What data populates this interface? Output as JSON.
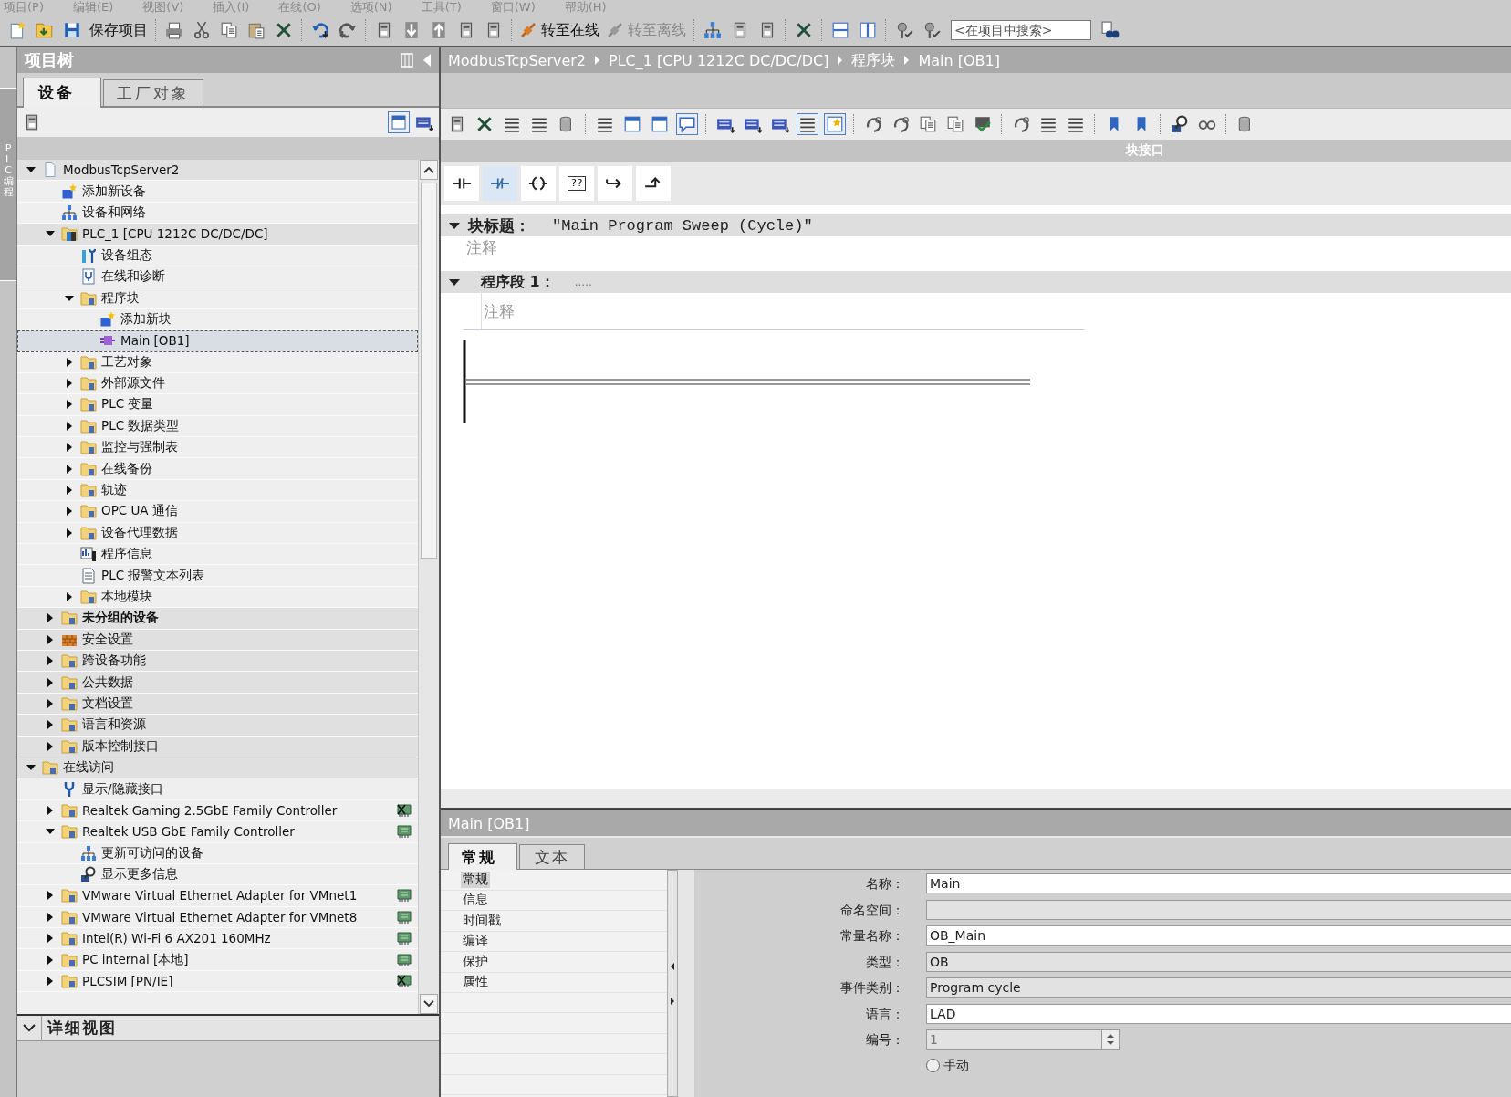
{
  "menu": [
    {
      "label": "项目(P)"
    },
    {
      "label": "编辑(E)"
    },
    {
      "label": "视图(V)"
    },
    {
      "label": "插入(I)"
    },
    {
      "label": "在线(O)"
    },
    {
      "label": "选项(N)"
    },
    {
      "label": "工具(T)"
    },
    {
      "label": "窗口(W)"
    },
    {
      "label": "帮助(H)"
    }
  ],
  "toolbar": {
    "buttons": [
      {
        "label": "保存项目",
        "disabled": false
      },
      {
        "label": "转至在线",
        "disabled": false
      },
      {
        "label": "转至离线",
        "disabled": true
      }
    ],
    "search": {
      "placeholder": "<在项目中搜索>"
    }
  },
  "side_tab": {
    "label": "PLC 编程"
  },
  "project_tree": {
    "title": "项目树",
    "tabs": [
      {
        "label": "设备",
        "selected": true
      },
      {
        "label": "工厂对象",
        "selected": false
      }
    ],
    "items": [
      {
        "label": "ModbusTcpServer2",
        "kind": "project",
        "shaded": true,
        "selected": false,
        "expanded": true,
        "children": [
          {
            "label": "添加新设备",
            "kind": "add",
            "shaded": false,
            "selected": false
          },
          {
            "label": "设备和网络",
            "kind": "network",
            "shaded": false,
            "selected": false
          },
          {
            "label": "PLC_1 [CPU 1212C DC/DC/DC]",
            "kind": "plc",
            "shaded": true,
            "selected": false,
            "expanded": true,
            "children": [
              {
                "label": "设备组态",
                "kind": "config",
                "shaded": false,
                "selected": false
              },
              {
                "label": "在线和诊断",
                "kind": "diagnostics",
                "shaded": false,
                "selected": false
              },
              {
                "label": "程序块",
                "kind": "folder",
                "shaded": false,
                "selected": false,
                "expanded": true,
                "children": [
                  {
                    "label": "添加新块",
                    "kind": "add",
                    "shaded": false,
                    "selected": false
                  },
                  {
                    "label": "Main [OB1]",
                    "kind": "block",
                    "shaded": false,
                    "selected": true
                  }
                ]
              },
              {
                "label": "工艺对象",
                "kind": "folder",
                "shaded": false,
                "selected": false,
                "expanded": false
              },
              {
                "label": "外部源文件",
                "kind": "folder",
                "shaded": false,
                "selected": false,
                "expanded": false
              },
              {
                "label": "PLC 变量",
                "kind": "folder",
                "shaded": false,
                "selected": false,
                "expanded": false
              },
              {
                "label": "PLC 数据类型",
                "kind": "folder",
                "shaded": false,
                "selected": false,
                "expanded": false
              },
              {
                "label": "监控与强制表",
                "kind": "folder",
                "shaded": false,
                "selected": false,
                "expanded": false
              },
              {
                "label": "在线备份",
                "kind": "folder",
                "shaded": false,
                "selected": false,
                "expanded": false
              },
              {
                "label": "轨迹",
                "kind": "folder",
                "shaded": false,
                "selected": false,
                "expanded": false
              },
              {
                "label": "OPC UA 通信",
                "kind": "folder",
                "shaded": false,
                "selected": false,
                "expanded": false
              },
              {
                "label": "设备代理数据",
                "kind": "folder",
                "shaded": false,
                "selected": false,
                "expanded": false
              },
              {
                "label": "程序信息",
                "kind": "info",
                "shaded": false,
                "selected": false
              },
              {
                "label": "PLC 报警文本列表",
                "kind": "document",
                "shaded": false,
                "selected": false
              },
              {
                "label": "本地模块",
                "kind": "folder",
                "shaded": false,
                "selected": false,
                "expanded": false
              }
            ]
          },
          {
            "label": "未分组的设备",
            "kind": "group",
            "shaded": true,
            "selected": false,
            "expanded": false
          },
          {
            "label": "安全设置",
            "kind": "security",
            "shaded": true,
            "selected": false,
            "expanded": false
          },
          {
            "label": "跨设备功能",
            "kind": "folder",
            "shaded": true,
            "selected": false,
            "expanded": false
          },
          {
            "label": "公共数据",
            "kind": "folder",
            "shaded": true,
            "selected": false,
            "expanded": false
          },
          {
            "label": "文档设置",
            "kind": "folder",
            "shaded": true,
            "selected": false,
            "expanded": false
          },
          {
            "label": "语言和资源",
            "kind": "folder",
            "shaded": true,
            "selected": false,
            "expanded": false
          },
          {
            "label": "版本控制接口",
            "kind": "folder",
            "shaded": true,
            "selected": false,
            "expanded": false
          }
        ]
      },
      {
        "label": "在线访问",
        "kind": "folder",
        "shaded": true,
        "selected": false,
        "expanded": true,
        "children": [
          {
            "label": "显示/隐藏接口",
            "kind": "wrench",
            "shaded": false,
            "selected": false
          },
          {
            "label": "Realtek Gaming 2.5GbE Family Controller",
            "kind": "adapter",
            "shaded": false,
            "selected": false,
            "expanded": false,
            "connected": false
          },
          {
            "label": "Realtek USB GbE Family Controller",
            "kind": "adapter",
            "shaded": false,
            "selected": false,
            "expanded": true,
            "connected": true,
            "children": [
              {
                "label": "更新可访问的设备",
                "kind": "network",
                "shaded": false,
                "selected": false
              },
              {
                "label": "显示更多信息",
                "kind": "search",
                "shaded": false,
                "selected": false
              }
            ]
          },
          {
            "label": "VMware Virtual Ethernet Adapter for VMnet1",
            "kind": "adapter",
            "shaded": false,
            "selected": false,
            "expanded": false,
            "connected": true
          },
          {
            "label": "VMware Virtual Ethernet Adapter for VMnet8",
            "kind": "adapter",
            "shaded": false,
            "selected": false,
            "expanded": false,
            "connected": true
          },
          {
            "label": "Intel(R) Wi-Fi 6 AX201 160MHz",
            "kind": "adapter",
            "shaded": false,
            "selected": false,
            "expanded": false,
            "connected": true
          },
          {
            "label": "PC internal [本地]",
            "kind": "adapter",
            "shaded": false,
            "selected": false,
            "expanded": false,
            "connected": true
          },
          {
            "label": "PLCSIM [PN/IE]",
            "kind": "adapter",
            "shaded": false,
            "selected": false,
            "expanded": false,
            "connected": false
          }
        ]
      }
    ]
  },
  "detail_view": {
    "title": "详细视图",
    "expanded": true
  },
  "editor": {
    "breadcrumb": [
      {
        "label": "ModbusTcpServer2"
      },
      {
        "label": "PLC_1 [CPU 1212C DC/DC/DC]"
      },
      {
        "label": "程序块"
      },
      {
        "label": "Main [OB1]"
      }
    ],
    "block_interface": {
      "label": "块接口"
    },
    "instructions": [
      {
        "kind": "contact",
        "selected": false
      },
      {
        "kind": "nc-contact",
        "selected": true
      },
      {
        "kind": "coil",
        "selected": false
      },
      {
        "kind": "box",
        "label": "??",
        "selected": false
      },
      {
        "kind": "open-branch",
        "selected": false
      },
      {
        "kind": "close-branch",
        "selected": false
      }
    ],
    "block_title": {
      "label": "块标题：",
      "value": "\"Main Program Sweep (Cycle)\"",
      "expanded": true,
      "comment": "注释"
    },
    "networks": [
      {
        "label": "程序段 1：",
        "title": ".....",
        "expanded": true,
        "comment": "注释"
      }
    ]
  },
  "inspector": {
    "title": "Main [OB1]",
    "tabs": [
      {
        "label": "常规",
        "selected": true
      },
      {
        "label": "文本",
        "selected": false
      }
    ],
    "nav": [
      {
        "label": "常规",
        "selected": true
      },
      {
        "label": "信息",
        "selected": false
      },
      {
        "label": "时间戳",
        "selected": false
      },
      {
        "label": "编译",
        "selected": false
      },
      {
        "label": "保护",
        "selected": false
      },
      {
        "label": "属性",
        "selected": false
      }
    ],
    "fields": [
      {
        "kind": "text",
        "label": "名称：",
        "value": "Main",
        "readonly": false
      },
      {
        "kind": "text",
        "label": "命名空间：",
        "readonly": true
      },
      {
        "kind": "text",
        "label": "常量名称：",
        "value": "OB_Main",
        "readonly": false
      },
      {
        "kind": "text",
        "label": "类型：",
        "value": "OB",
        "readonly": true
      },
      {
        "kind": "text",
        "label": "事件类别：",
        "value": "Program cycle",
        "readonly": true
      },
      {
        "kind": "text",
        "label": "语言：",
        "value": "LAD",
        "readonly": false
      },
      {
        "kind": "spin",
        "label": "编号：",
        "value": "1",
        "disabled": true
      },
      {
        "kind": "radio",
        "label": "手动",
        "checked": false
      }
    ]
  }
}
